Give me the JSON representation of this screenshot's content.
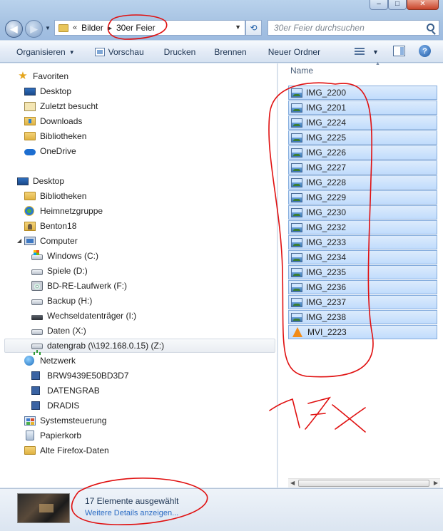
{
  "address": {
    "overflow": "«",
    "segments": [
      "Bilder",
      "30er Feier"
    ]
  },
  "search": {
    "placeholder": "30er Feier durchsuchen"
  },
  "toolbar": {
    "organize": "Organisieren",
    "preview": "Vorschau",
    "print": "Drucken",
    "burn": "Brennen",
    "new_folder": "Neuer Ordner"
  },
  "nav": {
    "favorites": {
      "title": "Favoriten",
      "items": [
        "Desktop",
        "Zuletzt besucht",
        "Downloads",
        "Bibliotheken",
        "OneDrive"
      ]
    },
    "desktop": {
      "title": "Desktop",
      "items": [
        "Bibliotheken",
        "Heimnetzgruppe",
        "Benton18",
        "Computer"
      ]
    },
    "drives": [
      "Windows (C:)",
      "Spiele (D:)",
      "BD-RE-Laufwerk (F:)",
      "Backup (H:)",
      "Wechseldatenträger (I:)",
      "Daten (X:)",
      "datengrab (\\\\192.168.0.15) (Z:)"
    ],
    "network": {
      "title": "Netzwerk",
      "items": [
        "BRW9439E50BD3D7",
        "DATENGRAB",
        "DRADIS"
      ]
    },
    "tail": [
      "Systemsteuerung",
      "Papierkorb",
      "Alte Firefox-Daten"
    ]
  },
  "files": {
    "column_name": "Name",
    "items": [
      "IMG_2200",
      "IMG_2201",
      "IMG_2224",
      "IMG_2225",
      "IMG_2226",
      "IMG_2227",
      "IMG_2228",
      "IMG_2229",
      "IMG_2230",
      "IMG_2232",
      "IMG_2233",
      "IMG_2234",
      "IMG_2235",
      "IMG_2236",
      "IMG_2237",
      "IMG_2238",
      "MVI_2223"
    ]
  },
  "details": {
    "count": "17 Elemente ausgewählt",
    "more": "Weitere Details anzeigen..."
  },
  "annotations": {
    "handwritten": "17x"
  },
  "colors": {
    "selection": "#c1dcfc",
    "selection_border": "#84acdd",
    "annotation_red": "#e01010"
  }
}
